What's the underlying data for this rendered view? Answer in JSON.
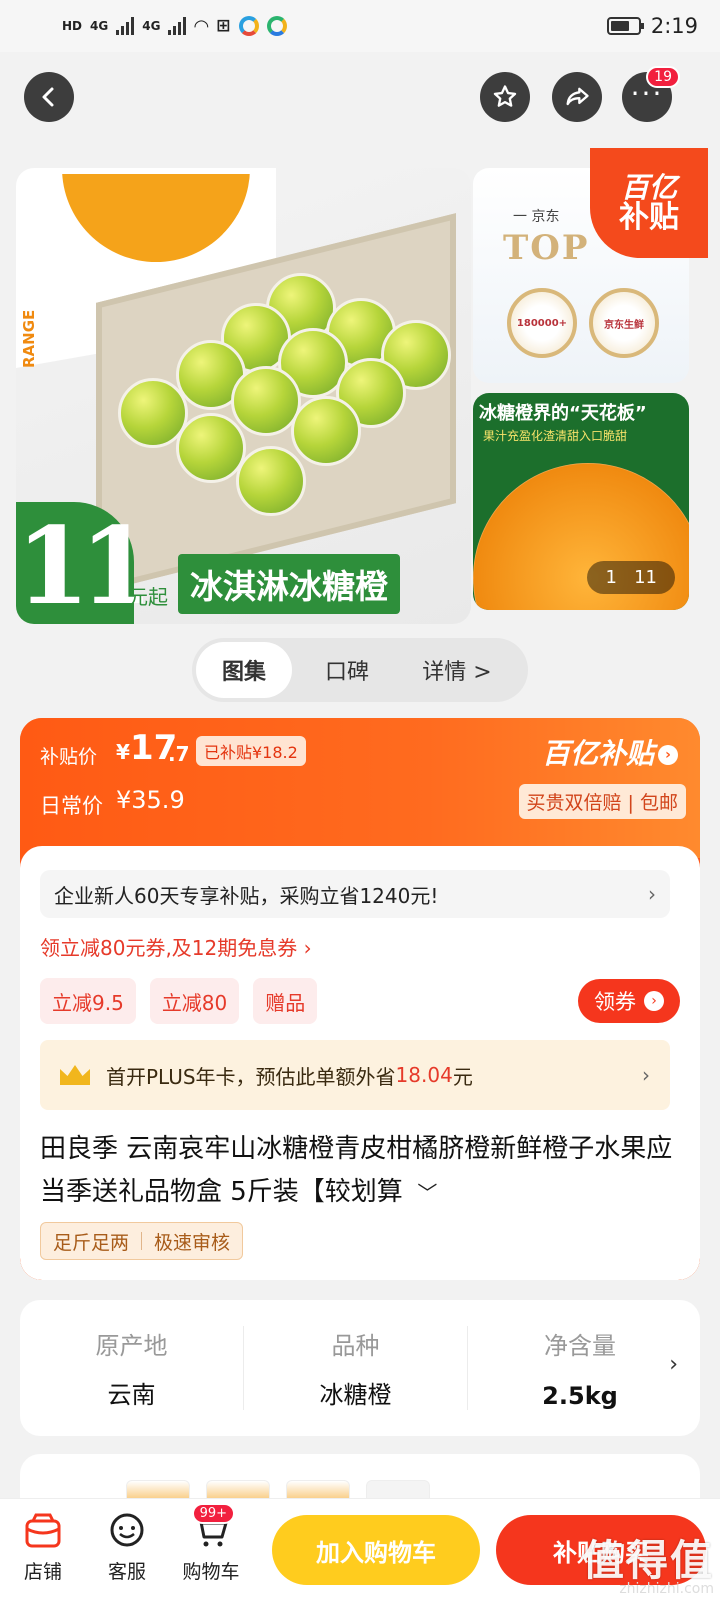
{
  "status_bar": {
    "time": "2:19",
    "network_1": "4G",
    "network_2": "4G",
    "hd": "HD"
  },
  "nav": {
    "more_badge": "19"
  },
  "gallery": {
    "main_price": "11",
    "main_price_suffix": "元起",
    "main_product_name": "冰淇淋冰糖橙",
    "box_text": "RANGE",
    "side1_text": "一 京东",
    "side1_top": "TOP",
    "side1_medal1": "180000+",
    "side1_medal2": "京东生鲜",
    "side2_title": "冰糖橙界的“天花板”",
    "side2_sub": "果汁充盈化渣清甜入口脆甜",
    "counter_current": "1",
    "counter_total": "11",
    "subsidy_corner_line1": "百亿",
    "subsidy_corner_line2": "补贴"
  },
  "gallery_tabs": [
    {
      "label": "图集",
      "active": true
    },
    {
      "label": "口碑",
      "active": false
    },
    {
      "label": "详情 >",
      "active": false
    }
  ],
  "price": {
    "subsidy_label": "补贴价",
    "currency": "¥",
    "subsidy_int": "17",
    "subsidy_dec": ".7",
    "subsidized_pill": "已补贴¥18.2",
    "daily_label": "日常价",
    "daily_price": "¥35.9",
    "brand": "百亿补贴",
    "guarantee": "买贵双倍赔 | 包邮"
  },
  "promo": {
    "enterprise_text": "企业新人60天专享补贴，采购立省1240元!",
    "coupon_line": "领立减80元券,及12期免息券 ›",
    "chips": [
      "立减9.5",
      "立减80",
      "赠品"
    ],
    "coupon_button": "领券",
    "plus_text": "首开PLUS年卡，预估此单额外省",
    "plus_amount": "18.04",
    "plus_unit": "元"
  },
  "product": {
    "title": "田良季 云南哀牢山冰糖橙青皮柑橘脐橙新鲜橙子水果应当季送礼品物盒 5斤装【较划算",
    "tags": [
      "足斤足两",
      "极速审核"
    ]
  },
  "attributes": [
    {
      "key": "原产地",
      "value": "云南"
    },
    {
      "key": "品种",
      "value": "冰糖橙"
    },
    {
      "key": "净含量",
      "value": "2.5kg"
    }
  ],
  "bottom_bar": {
    "shop": "店铺",
    "service": "客服",
    "cart": "购物车",
    "cart_badge": "99+",
    "add_to_cart": "加入购物车",
    "buy_now": "补贴购买",
    "watermark": "值得值",
    "watermark_url": "zhizhizhi.com"
  },
  "colors": {
    "accent": "#f5361d",
    "subsidy_orange": "#ff5a1c",
    "cart_yellow": "#ffcc1e",
    "green_tag": "#2e8f3b"
  }
}
